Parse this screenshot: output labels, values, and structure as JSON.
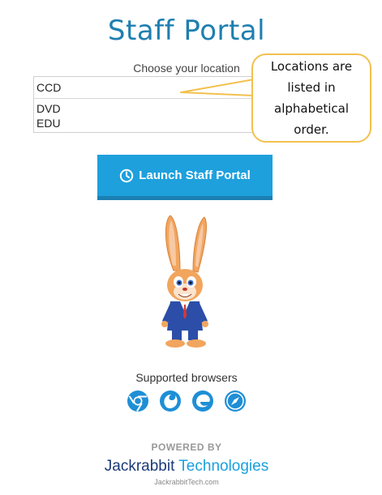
{
  "title": "Staff Portal",
  "location_label": "Choose your location",
  "locations": [
    "CCD",
    "DVD",
    "EDU"
  ],
  "callout": "Locations are listed in alphabetical order.",
  "launch_button": {
    "label": "Launch Staff Portal",
    "icon": "clock-icon"
  },
  "browsers_label": "Supported browsers",
  "browsers": [
    "chrome-icon",
    "firefox-icon",
    "edge-icon",
    "safari-icon"
  ],
  "footer": {
    "powered_by": "POWERED BY",
    "brand_part1": "Jackrabbit",
    "brand_part2": " Technologies",
    "site": "JackrabbitTech.com"
  },
  "colors": {
    "title": "#1f7fb0",
    "button": "#1ea0dd",
    "callout_border": "#f2c14e",
    "brand_dark": "#1b3a78",
    "brand_light": "#1aa0dc"
  }
}
